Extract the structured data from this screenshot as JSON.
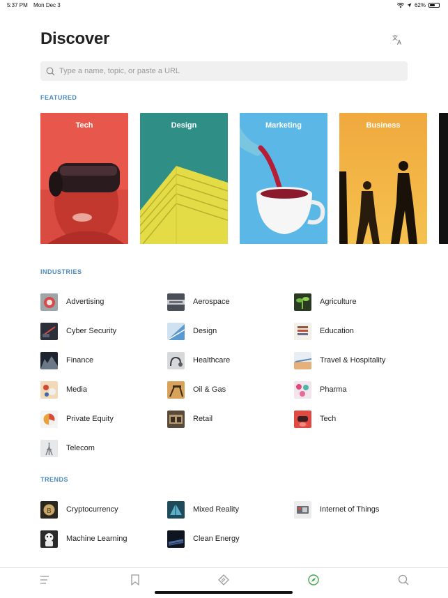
{
  "status": {
    "time": "5:37 PM",
    "date": "Mon Dec 3",
    "battery": "62%",
    "battery_level": 0.62
  },
  "header": {
    "title": "Discover"
  },
  "search": {
    "placeholder": "Type a name, topic, or paste a URL"
  },
  "featured": {
    "label": "FEATURED",
    "cards": [
      {
        "title": "Tech"
      },
      {
        "title": "Design"
      },
      {
        "title": "Marketing"
      },
      {
        "title": "Business"
      }
    ]
  },
  "industries": {
    "label": "INDUSTRIES",
    "items": [
      {
        "label": "Advertising"
      },
      {
        "label": "Aerospace"
      },
      {
        "label": "Agriculture"
      },
      {
        "label": "Cyber Security"
      },
      {
        "label": "Design"
      },
      {
        "label": "Education"
      },
      {
        "label": "Finance"
      },
      {
        "label": "Healthcare"
      },
      {
        "label": "Travel & Hospitality"
      },
      {
        "label": "Media"
      },
      {
        "label": "Oil & Gas"
      },
      {
        "label": "Pharma"
      },
      {
        "label": "Private Equity"
      },
      {
        "label": "Retail"
      },
      {
        "label": "Tech"
      },
      {
        "label": "Telecom"
      }
    ]
  },
  "trends": {
    "label": "TRENDS",
    "items": [
      {
        "label": "Cryptocurrency"
      },
      {
        "label": "Mixed Reality"
      },
      {
        "label": "Internet of Things"
      },
      {
        "label": "Machine Learning"
      },
      {
        "label": "Clean Energy"
      }
    ]
  },
  "colors": {
    "accent": "#4a8bc2",
    "active_tab": "#3aa84a"
  },
  "tabs": [
    {
      "icon": "menu-icon"
    },
    {
      "icon": "bookmark-icon"
    },
    {
      "icon": "feedly-logo-icon"
    },
    {
      "icon": "compass-icon",
      "active": true
    },
    {
      "icon": "search-icon"
    }
  ]
}
